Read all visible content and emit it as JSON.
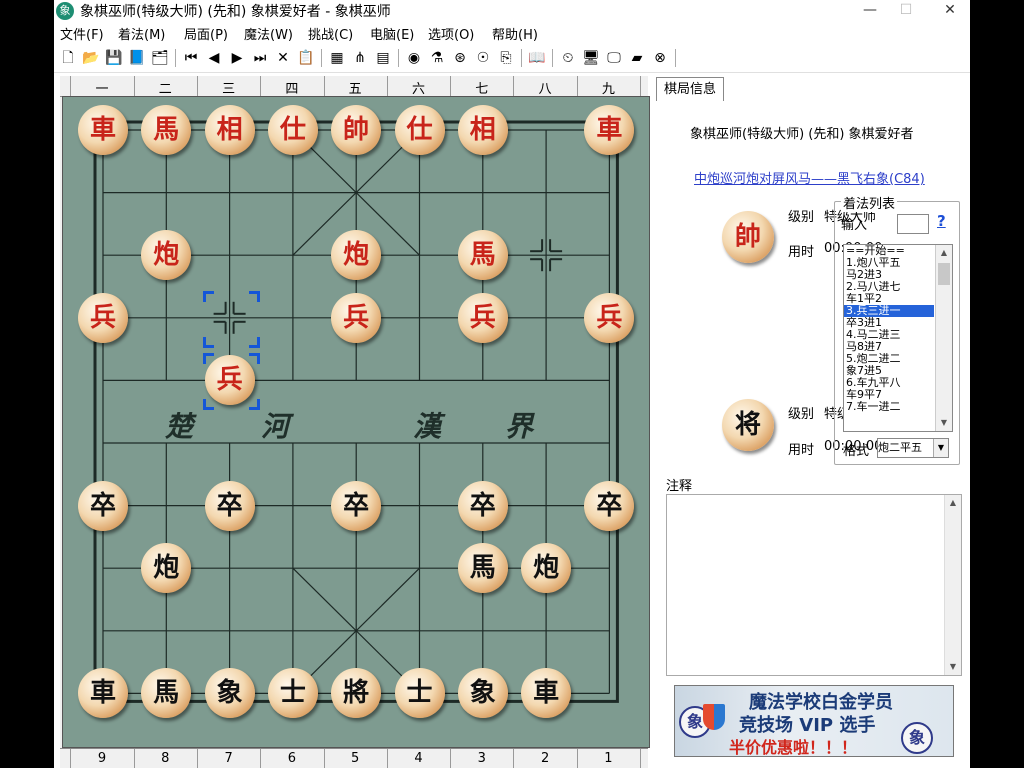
{
  "window": {
    "title": "象棋巫师(特级大师) (先和) 象棋爱好者 - 象棋巫师",
    "app_icon": "象",
    "controls": {
      "minimize": "—",
      "maximize": "☐",
      "close": "✕"
    }
  },
  "menu": [
    "文件(F)",
    "着法(M)",
    "局面(P)",
    "魔法(W)",
    "挑战(C)",
    "电脑(E)",
    "选项(O)",
    "帮助(H)"
  ],
  "toolbar": {
    "groups": [
      [
        {
          "name": "new-icon",
          "glyph": "🗋"
        },
        {
          "name": "open-icon",
          "glyph": "📂"
        },
        {
          "name": "save-icon",
          "glyph": "💾"
        },
        {
          "name": "notebook-icon",
          "glyph": "📘"
        },
        {
          "name": "properties-icon",
          "glyph": "🗂"
        }
      ],
      [
        {
          "name": "first-move-icon",
          "glyph": "⏮"
        },
        {
          "name": "prev-move-icon",
          "glyph": "◀"
        },
        {
          "name": "next-move-icon",
          "glyph": "▶"
        },
        {
          "name": "last-move-icon",
          "glyph": "⏭"
        },
        {
          "name": "delete-icon",
          "glyph": "✕"
        },
        {
          "name": "paste-icon",
          "glyph": "📋"
        }
      ],
      [
        {
          "name": "edit-position-icon",
          "glyph": "▦"
        },
        {
          "name": "tree-icon",
          "glyph": "⋔"
        },
        {
          "name": "book-red-icon",
          "glyph": "▤"
        }
      ],
      [
        {
          "name": "engine-icon",
          "glyph": "◉"
        },
        {
          "name": "analyze-icon",
          "glyph": "⚗"
        },
        {
          "name": "camera-icon",
          "glyph": "⊛"
        },
        {
          "name": "network-icon",
          "glyph": "☉"
        },
        {
          "name": "copy-icon",
          "glyph": "⎘"
        }
      ],
      [
        {
          "name": "book-icon",
          "glyph": "📖"
        }
      ],
      [
        {
          "name": "clock-icon",
          "glyph": "⏲"
        },
        {
          "name": "monitor-icon",
          "glyph": "🖥"
        },
        {
          "name": "screen-icon",
          "glyph": "🖵"
        },
        {
          "name": "chart-icon",
          "glyph": "▰"
        },
        {
          "name": "stop-icon",
          "glyph": "⊗"
        }
      ]
    ]
  },
  "board": {
    "columns_top": [
      "一",
      "二",
      "三",
      "四",
      "五",
      "六",
      "七",
      "八",
      "九"
    ],
    "columns_bottom": [
      "9",
      "8",
      "7",
      "6",
      "5",
      "4",
      "3",
      "2",
      "1"
    ],
    "river_left": [
      "楚",
      "河"
    ],
    "river_right": [
      "漢",
      "界"
    ],
    "pieces": [
      {
        "side": "red",
        "char": "車",
        "file": 0,
        "rank": 0
      },
      {
        "side": "red",
        "char": "馬",
        "file": 1,
        "rank": 0
      },
      {
        "side": "red",
        "char": "相",
        "file": 2,
        "rank": 0
      },
      {
        "side": "red",
        "char": "仕",
        "file": 3,
        "rank": 0
      },
      {
        "side": "red",
        "char": "帥",
        "file": 4,
        "rank": 0
      },
      {
        "side": "red",
        "char": "仕",
        "file": 5,
        "rank": 0
      },
      {
        "side": "red",
        "char": "相",
        "file": 6,
        "rank": 0
      },
      {
        "side": "red",
        "char": "車",
        "file": 8,
        "rank": 0
      },
      {
        "side": "red",
        "char": "炮",
        "file": 1,
        "rank": 2
      },
      {
        "side": "red",
        "char": "炮",
        "file": 4,
        "rank": 2
      },
      {
        "side": "red",
        "char": "馬",
        "file": 6,
        "rank": 2
      },
      {
        "side": "red",
        "char": "兵",
        "file": 0,
        "rank": 3
      },
      {
        "side": "red",
        "char": "兵",
        "file": 4,
        "rank": 3
      },
      {
        "side": "red",
        "char": "兵",
        "file": 6,
        "rank": 3
      },
      {
        "side": "red",
        "char": "兵",
        "file": 8,
        "rank": 3
      },
      {
        "side": "red",
        "char": "兵",
        "file": 2,
        "rank": 4
      },
      {
        "side": "black",
        "char": "卒",
        "file": 0,
        "rank": 6
      },
      {
        "side": "black",
        "char": "卒",
        "file": 2,
        "rank": 6
      },
      {
        "side": "black",
        "char": "卒",
        "file": 4,
        "rank": 6
      },
      {
        "side": "black",
        "char": "卒",
        "file": 6,
        "rank": 6
      },
      {
        "side": "black",
        "char": "卒",
        "file": 8,
        "rank": 6
      },
      {
        "side": "black",
        "char": "炮",
        "file": 1,
        "rank": 7
      },
      {
        "side": "black",
        "char": "馬",
        "file": 6,
        "rank": 7
      },
      {
        "side": "black",
        "char": "炮",
        "file": 7,
        "rank": 7
      },
      {
        "side": "black",
        "char": "車",
        "file": 0,
        "rank": 9
      },
      {
        "side": "black",
        "char": "馬",
        "file": 1,
        "rank": 9
      },
      {
        "side": "black",
        "char": "象",
        "file": 2,
        "rank": 9
      },
      {
        "side": "black",
        "char": "士",
        "file": 3,
        "rank": 9
      },
      {
        "side": "black",
        "char": "將",
        "file": 4,
        "rank": 9
      },
      {
        "side": "black",
        "char": "士",
        "file": 5,
        "rank": 9
      },
      {
        "side": "black",
        "char": "象",
        "file": 6,
        "rank": 9
      },
      {
        "side": "black",
        "char": "車",
        "file": 7,
        "rank": 9
      }
    ],
    "last_move": {
      "from": {
        "file": 2,
        "rank": 3
      },
      "to": {
        "file": 2,
        "rank": 4
      }
    },
    "empty_crosshair": {
      "file": 7,
      "rank": 2
    }
  },
  "info": {
    "tab": "棋局信息",
    "players": "象棋巫师(特级大师) (先和) 象棋爱好者",
    "opening": "中炮巡河炮对屏风马——黑飞右象(C84)",
    "red": {
      "piece": "帥",
      "level_label": "级别",
      "level": "特级大师",
      "time_label": "用时",
      "time": "00:00:00"
    },
    "black": {
      "piece": "将",
      "level_label": "级别",
      "level": "特级大师",
      "time_label": "用时",
      "time": "00:00:00"
    },
    "movelist": {
      "title": "着法列表",
      "input_label": "输入",
      "help": "?",
      "items": [
        "==开始==",
        "1.炮八平五",
        "马2进3",
        "2.马八进七",
        "车1平2",
        "3.兵三进一",
        "卒3进1",
        "4.马二进三",
        "马8进7",
        "5.炮二进二",
        "象7进5",
        "6.车九平八",
        "车9平7",
        "7.车一进二"
      ],
      "selected": 5,
      "format_label": "格式",
      "format_value": "炮二平五"
    },
    "notes_label": "注释"
  },
  "banner": {
    "line1": "魔法学校白金学员",
    "line2": "竞技场 VIP 选手",
    "line3": "半价优惠啦！！！",
    "left_piece": "象",
    "right_piece": "象"
  }
}
